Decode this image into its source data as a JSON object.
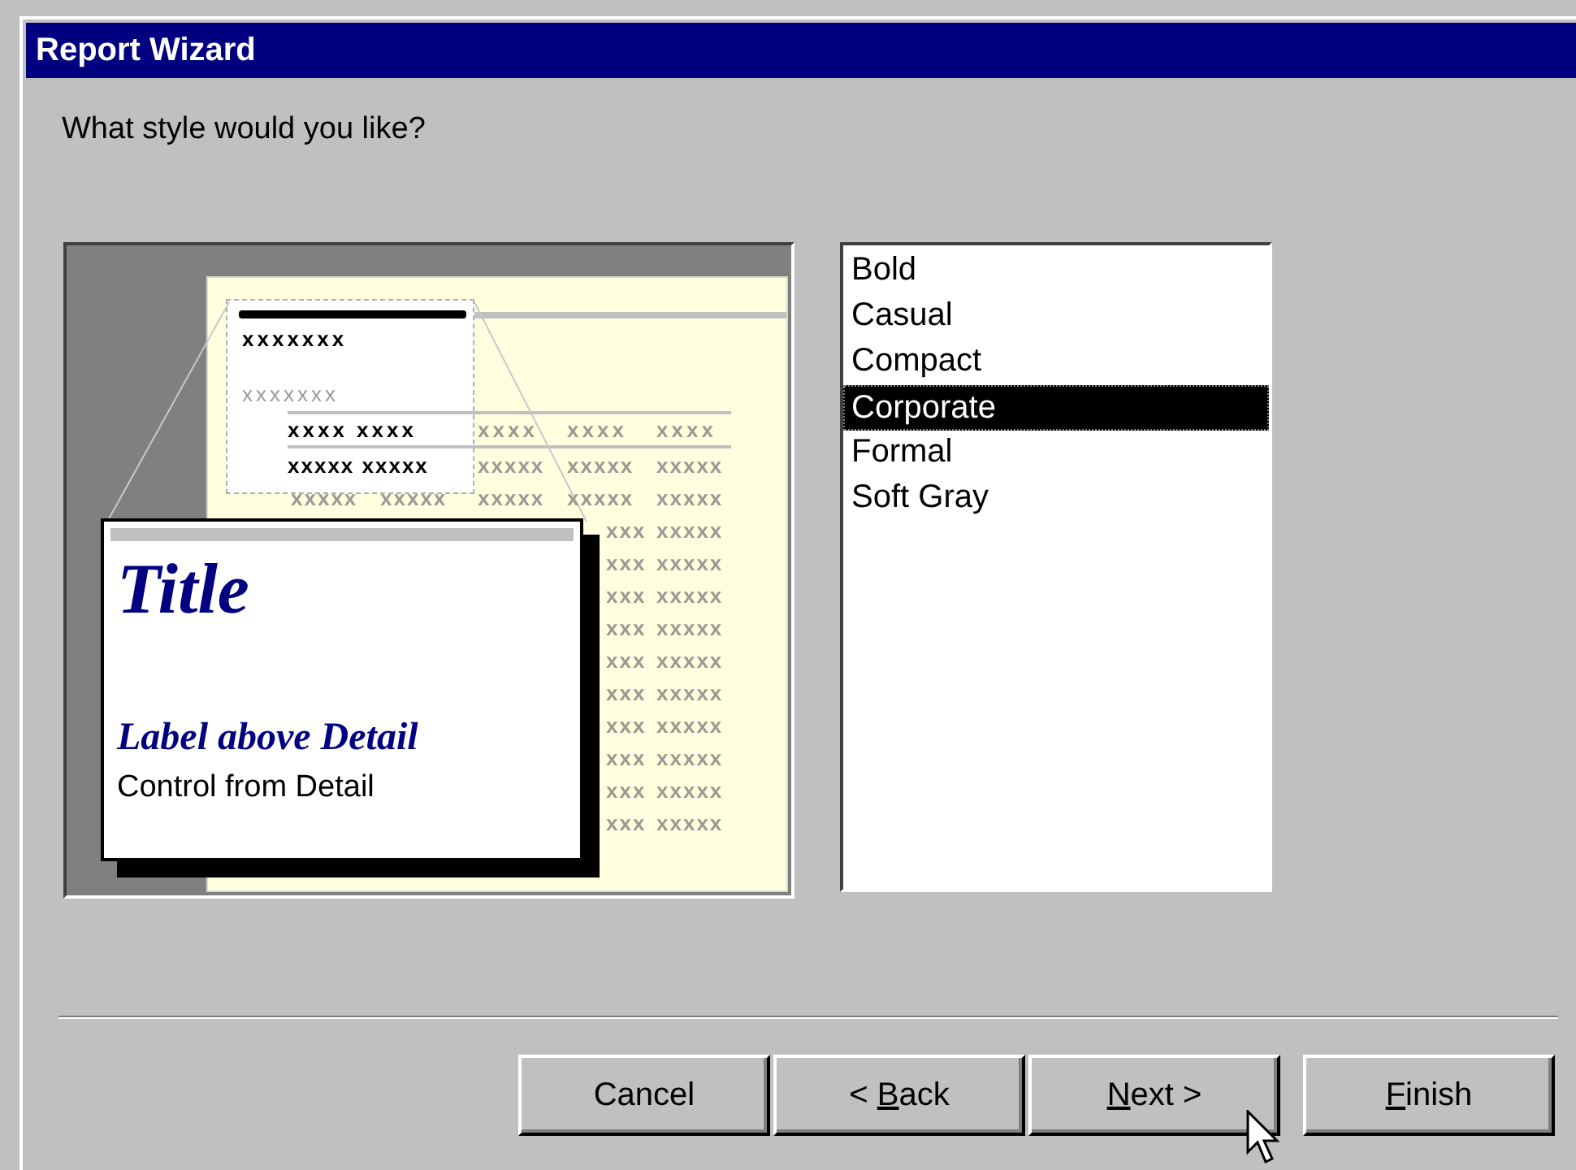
{
  "window": {
    "title": "Report Wizard"
  },
  "prompt": "What style would you like?",
  "preview": {
    "zoom_heading": "xxxxxxx",
    "zoom_group": "xxxxxxx",
    "zoom_column_headers": "xxxx xxxx",
    "zoom_detail": "xxxxx xxxxx",
    "page_header_cells": [
      "xxxx",
      "xxxx",
      "xxxx"
    ],
    "page_rows": [
      [
        "xxxxx",
        "xxxxx",
        "xxxxx"
      ],
      [
        "xxxxx",
        "xxxxx",
        "xxxxx",
        "xxxxx",
        "xxxxx"
      ],
      [
        "xxx",
        "xxxxx"
      ],
      [
        "xxx",
        "xxxxx"
      ],
      [
        "xxx",
        "xxxxx"
      ],
      [
        "xxx",
        "xxxxx"
      ],
      [
        "xxx",
        "xxxxx"
      ],
      [
        "xxx",
        "xxxxx"
      ],
      [
        "xxx",
        "xxxxx"
      ],
      [
        "xxx",
        "xxxxx"
      ],
      [
        "xxx",
        "xxxxx"
      ],
      [
        "xxx",
        "xxxxx"
      ]
    ],
    "sample_title": "Title",
    "sample_label": "Label above Detail",
    "sample_control": "Control from Detail"
  },
  "styles": [
    {
      "label": "Bold",
      "selected": false
    },
    {
      "label": "Casual",
      "selected": false
    },
    {
      "label": "Compact",
      "selected": false
    },
    {
      "label": "Corporate",
      "selected": true
    },
    {
      "label": "Formal",
      "selected": false
    },
    {
      "label": "Soft Gray",
      "selected": false
    }
  ],
  "buttons": [
    {
      "parts": [
        {
          "text": "Cancel",
          "underline": false
        }
      ]
    },
    {
      "parts": [
        {
          "text": "< ",
          "underline": false
        },
        {
          "text": "B",
          "underline": true
        },
        {
          "text": "ack",
          "underline": false
        }
      ]
    },
    {
      "parts": [
        {
          "text": "N",
          "underline": true
        },
        {
          "text": "ext >",
          "underline": false
        }
      ]
    },
    {
      "parts": [
        {
          "text": "F",
          "underline": true
        },
        {
          "text": "inish",
          "underline": false
        }
      ]
    }
  ]
}
